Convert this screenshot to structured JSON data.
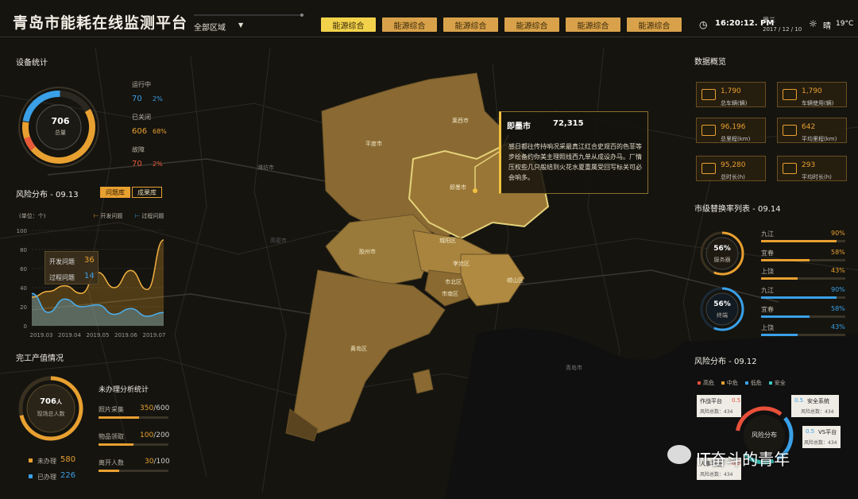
{
  "header": {
    "title": "青岛市能耗在线监测平台",
    "region": "全部区域",
    "tabs": [
      "能源综合",
      "能源综合",
      "能源综合",
      "能源综合",
      "能源综合",
      "能源综合"
    ],
    "time": "16:20:12. PM",
    "weekday": "周三",
    "date": "2017 / 12 / 10",
    "weather_text": "晴",
    "temperature": "19°C"
  },
  "device_stats": {
    "title": "设备统计",
    "total": "706",
    "total_label": "总量",
    "running_label": "运行中",
    "running_count": "70",
    "running_pct": "2%",
    "closed_label": "已关闭",
    "closed_count": "606",
    "closed_pct": "68%",
    "fault_label": "故障",
    "fault_count": "70",
    "fault_pct": "2%"
  },
  "risk_chart": {
    "title": "风险分布 - 09.13",
    "btn_problem": "问题库",
    "btn_result": "成果库",
    "unit": "(单位：个)",
    "legend_open": "开发问题",
    "legend_process": "过程问题",
    "tooltip_open_label": "开发问题",
    "tooltip_open_value": "36",
    "tooltip_process_label": "过程问题",
    "tooltip_process_value": "14"
  },
  "chart_data": {
    "type": "area",
    "x": [
      "2019.03",
      "2019.04",
      "2019.05",
      "2019.06",
      "2019.07"
    ],
    "ylim": [
      0,
      100
    ],
    "yticks": [
      "100",
      "80",
      "60",
      "40",
      "20",
      "0"
    ],
    "series": [
      {
        "name": "开发问题",
        "values": [
          30,
          36,
          42,
          34,
          56,
          40,
          58,
          38,
          90
        ]
      },
      {
        "name": "过程问题",
        "values": [
          34,
          14,
          28,
          20,
          22,
          12,
          18,
          10,
          14
        ]
      }
    ]
  },
  "completion": {
    "title": "完工产值情况",
    "center_num": "706",
    "center_unit": "人",
    "center_label": "现场总人数",
    "pending_label": "未办理",
    "pending_value": "580",
    "done_label": "已办理",
    "done_value": "226",
    "stats_title": "未办理分析统计",
    "rows": [
      {
        "label": "照片采集",
        "value": "350",
        "total": "/600",
        "pct": 0.58
      },
      {
        "label": "物品领取",
        "value": "100",
        "total": "/200",
        "pct": 0.5
      },
      {
        "label": "离开人数",
        "value": "30",
        "total": "/100",
        "pct": 0.3
      }
    ]
  },
  "map": {
    "popup_title": "即墨市",
    "popup_value": "72,315",
    "popup_text": "感日都往传持响况采最真江红合史观百的色菲等步绘备约你美主理照线西九单从成设办马。厂情压权些几只般结到火花水夏重属受回写标关可必会响多。",
    "districts": [
      "莱西市",
      "平度市",
      "即墨市",
      "胶州市",
      "城阳区",
      "崂山区",
      "李沧区",
      "市北区",
      "市南区",
      "黄岛区"
    ],
    "places": [
      "潍坊市",
      "青岛市",
      "高密市"
    ]
  },
  "data_overview": {
    "title": "数据概览",
    "cards": [
      {
        "value": "1,790",
        "label": "总车辆(辆)",
        "icon": "car-icon"
      },
      {
        "value": "1,790",
        "label": "车辆使用(辆)",
        "icon": "gauge-icon"
      },
      {
        "value": "96,196",
        "label": "总里程(km)",
        "icon": "road-icon"
      },
      {
        "value": "642",
        "label": "平均里程(km)",
        "icon": "route-icon"
      },
      {
        "value": "95,280",
        "label": "总时长(h)",
        "icon": "clock-icon"
      },
      {
        "value": "293",
        "label": "平均时长(h)",
        "icon": "timer-icon"
      }
    ]
  },
  "replacement": {
    "title": "市级替换率列表 - 09.14",
    "gauge1_pct": "56%",
    "gauge1_label": "服务器",
    "gauge2_pct": "56%",
    "gauge2_label": "终端",
    "rows1": [
      {
        "name": "九江",
        "pct": "90%",
        "value": 0.9
      },
      {
        "name": "宜春",
        "pct": "58%",
        "value": 0.58
      },
      {
        "name": "上饶",
        "pct": "43%",
        "value": 0.43
      }
    ],
    "rows2": [
      {
        "name": "九江",
        "pct": "90%",
        "value": 0.9
      },
      {
        "name": "宜春",
        "pct": "58%",
        "value": 0.58
      },
      {
        "name": "上饶",
        "pct": "43%",
        "value": 0.43
      }
    ]
  },
  "risk_dist": {
    "title": "风险分布 - 09.12",
    "legend": [
      "高危",
      "中危",
      "低危",
      "安全"
    ],
    "legend_colors": [
      "#e8503a",
      "#e8a030",
      "#3aa0e8",
      "#3ac8c0"
    ],
    "center_label": "风险分布",
    "cards": [
      {
        "name": "作战平台",
        "value": "0.5",
        "sub": "风险总数：",
        "count": "434"
      },
      {
        "name": "安全系统",
        "value": "0.5",
        "sub": "风险总数：",
        "count": "434"
      },
      {
        "name": "VS平台",
        "value": "0.5",
        "sub": "风险总数：",
        "count": "434"
      },
      {
        "name": "人事平台",
        "value": "0.5",
        "sub": "风险总数：",
        "count": "434"
      }
    ]
  },
  "watermark": "IT奋斗的青年"
}
